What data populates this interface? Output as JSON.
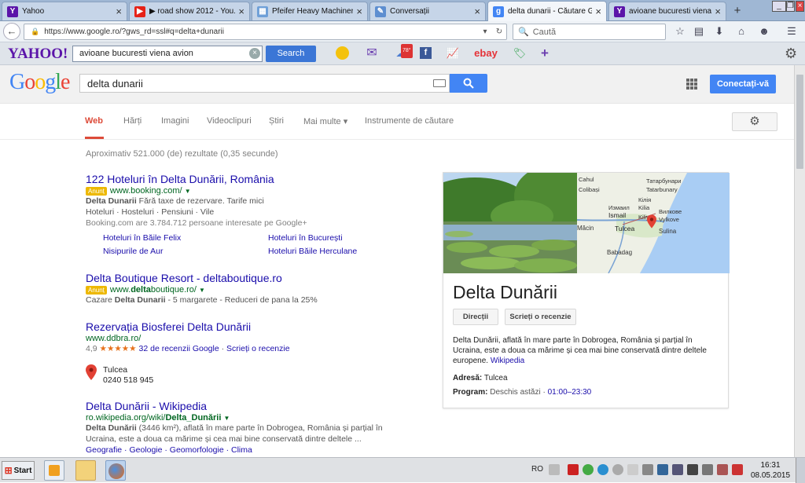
{
  "browser": {
    "tabs": [
      {
        "label": "Yahoo",
        "icon": "yahoo-icon",
        "color": "#5b14a9",
        "glyph": "Y"
      },
      {
        "label": "▶ road show 2012 - You...",
        "icon": "youtube-icon",
        "color": "#e62117",
        "glyph": "▶"
      },
      {
        "label": "Pfeifer Heavy Machinery ...",
        "icon": "page-icon",
        "color": "#6fa0d8",
        "glyph": "▦"
      },
      {
        "label": "Conversații",
        "icon": "chat-icon",
        "color": "#5d8ed0",
        "glyph": "✎"
      },
      {
        "label": "delta dunarii - Căutare G...",
        "icon": "google-icon",
        "color": "#4285f4",
        "glyph": "g"
      },
      {
        "label": "avioane bucuresti viena ...",
        "icon": "yahoo-icon",
        "color": "#5b14a9",
        "glyph": "Y"
      }
    ],
    "url": "https://www.google.ro/?gws_rd=ssl#q=delta+dunarii",
    "search_placeholder": "Caută"
  },
  "yahoo": {
    "logo": "YAHOO!",
    "query": "avioane bucuresti viena avion",
    "search_label": "Search",
    "weather_badge": "78°",
    "ebay": "ebay"
  },
  "google": {
    "logo": "Google",
    "query": "delta dunarii",
    "signin": "Conectați-vă",
    "tabs": [
      "Web",
      "Hărți",
      "Imagini",
      "Videoclipuri",
      "Știri",
      "Mai multe ▾",
      "Instrumente de căutare"
    ],
    "stats": "Aproximativ 521.000 (de) rezultate (0,35 secunde)"
  },
  "results": {
    "r1": {
      "title": "122 Hoteluri în Delta Dunării, România",
      "badge": "Anunț",
      "url": "www.booking.com/",
      "line1_bold": "Delta Dunarii",
      "line1": " Fără taxe de rezervare. Tarife mici",
      "line2": "Hoteluri · Hosteluri · Pensiuni · Vile",
      "line3": "Booking.com are 3.784.712 persoane interesate pe Google+",
      "sitelinks": [
        "Hoteluri în Băile Felix",
        "Hoteluri în București",
        "Nisipurile de Aur",
        "Hoteluri Băile Herculane"
      ]
    },
    "r2": {
      "title": "Delta Boutique Resort - deltaboutique.ro",
      "badge": "Anunț",
      "url_pre": "www.",
      "url_bold": "delta",
      "url_post": "boutique.ro/",
      "line1_pre": "Cazare ",
      "line1_bold": "Delta Dunarii",
      "line1_post": " - 5 margarete - Reduceri de pana la 25%"
    },
    "r3": {
      "title": "Rezervația Biosferei Delta Dunării",
      "url": "www.ddbra.ro/",
      "rating": "4,9",
      "stars": "★★★★★",
      "reviews": "32 de recenzii Google",
      "write": "Scrieți o recenzie",
      "place": "Tulcea",
      "phone": "0240 518 945"
    },
    "r4": {
      "title": "Delta Dunării - Wikipedia",
      "url_pre": "ro.wikipedia.org/wiki/",
      "url_bold": "Delta_Dunării",
      "line1_bold": "Delta Dunării",
      "line1": " (3446 km²), aflată în mare parte în Dobrogea, România și parțial în",
      "line2": "Ucraina, este a doua ca mărime și cea mai bine conservată dintre deltele ...",
      "links": "Geografie · Geologie · Geomorfologie · Clima"
    }
  },
  "knowledge": {
    "title": "Delta Dunării",
    "directions": "Direcții",
    "review": "Scrieți o recenzie",
    "desc": "Delta Dunării, aflată în mare parte în Dobrogea, România și parțial în Ucraina, este a doua ca mărime și cea mai bine conservată dintre deltele europene.",
    "wiki": "Wikipedia",
    "address_label": "Adresă:",
    "address": "Tulcea",
    "program_label": "Program:",
    "program_status": "Deschis astăzi",
    "program_hours": "01:00–23:30",
    "map_labels": [
      "Cahul",
      "Татарбунари",
      "Colibași",
      "Tatarbunary",
      "Kilia",
      "Ismail",
      "Кілія",
      "Измаил",
      "Kiliya",
      "Вилкове",
      "Vylkove",
      "Măcin",
      "Tulcea",
      "Sulina",
      "Babadag"
    ]
  },
  "taskbar": {
    "start": "Start",
    "lang": "RO",
    "time": "16:31",
    "date": "08.05.2015"
  },
  "colors": {
    "google_blue": "#4285f4",
    "link": "#1a0dab",
    "url_green": "#006621",
    "accent_red": "#dd4b39",
    "yahoo_purple": "#5b14a9"
  }
}
